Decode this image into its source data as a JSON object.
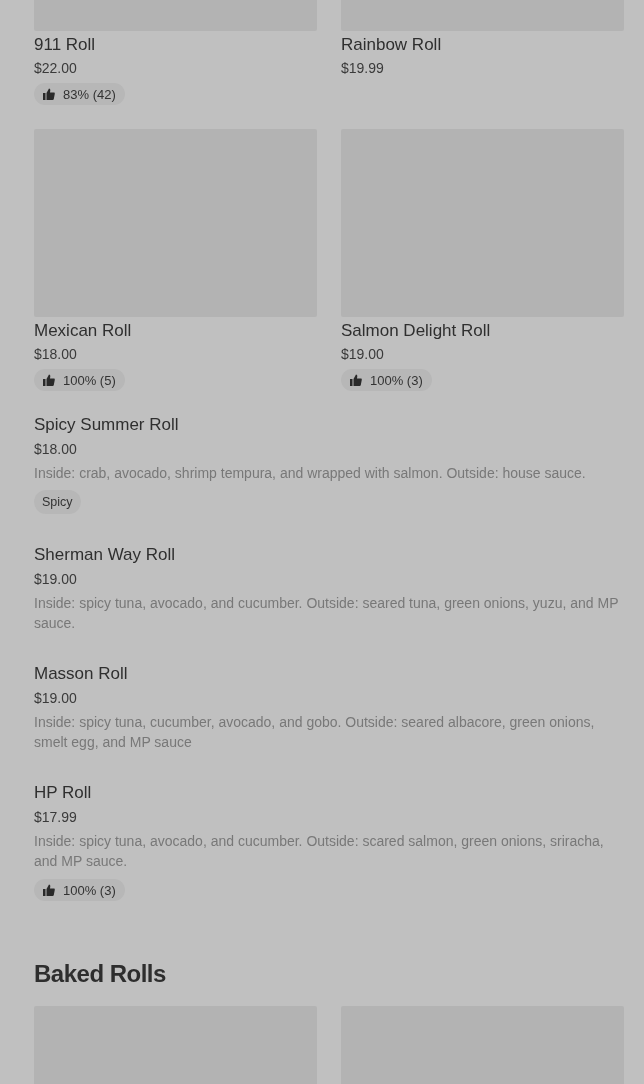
{
  "sections": [
    {
      "kind": "grid",
      "items": [
        {
          "kind": "card",
          "name": "911 Roll",
          "price": "$22.00",
          "rating": "83% (42)"
        },
        {
          "kind": "card",
          "name": "Rainbow Roll",
          "price": "$19.99"
        },
        {
          "kind": "card",
          "name": "Mexican Roll",
          "price": "$18.00",
          "rating": "100% (5)"
        },
        {
          "kind": "card",
          "name": "Salmon Delight Roll",
          "price": "$19.00",
          "rating": "100% (3)"
        }
      ]
    },
    {
      "kind": "list",
      "items": [
        {
          "name": "Spicy Summer Roll",
          "price": "$18.00",
          "description": "Inside: crab, avocado, shrimp tempura, and wrapped with salmon. Outside: house sauce.",
          "tag": "Spicy"
        },
        {
          "name": "Sherman Way Roll",
          "price": "$19.00",
          "description": "Inside: spicy tuna, avocado, and cucumber. Outside: seared tuna, green onions, yuzu, and MP sauce."
        },
        {
          "name": "Masson Roll",
          "price": "$19.00",
          "description": "Inside: spicy tuna, cucumber, avocado, and gobo. Outside: seared albacore, green onions, smelt egg, and MP sauce"
        },
        {
          "name": "HP Roll",
          "price": "$17.99",
          "description": "Inside: spicy tuna, avocado, and cucumber. Outside: scared salmon, green onions, sriracha, and MP sauce.",
          "rating": "100% (3)"
        }
      ]
    },
    {
      "kind": "grid",
      "title": "Baked Rolls",
      "items": [
        {
          "kind": "image-only"
        },
        {
          "kind": "image-only"
        }
      ]
    }
  ]
}
